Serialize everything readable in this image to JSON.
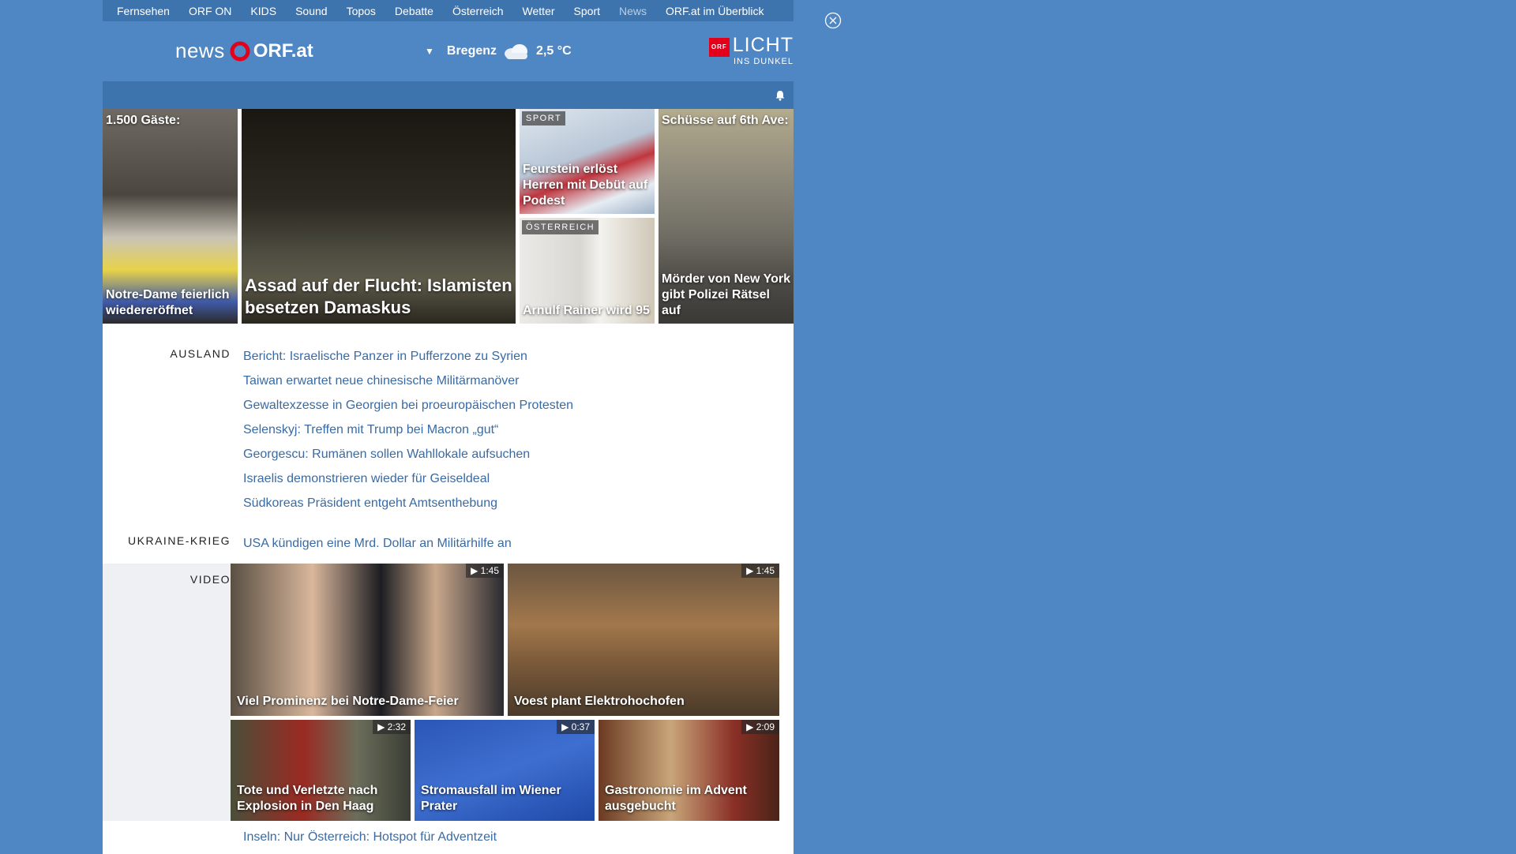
{
  "nav": {
    "items": [
      "Fernsehen",
      "ORF ON",
      "KIDS",
      "Sound",
      "Topos",
      "Debatte",
      "Österreich",
      "Wetter",
      "Sport",
      "News",
      "ORF.at im Überblick"
    ],
    "active": "News"
  },
  "header": {
    "logo_news": "news",
    "logo_orf": "ORF.at",
    "weather_city": "Bregenz",
    "weather_temp": "2,5 °C",
    "licht_badge": "ORF",
    "licht_line1": "LICHT",
    "licht_line2": "INS DUNKEL"
  },
  "hero": {
    "t1_top": "1.500 Gäste:",
    "t1_cap": "Notre-Dame feierlich wiedereröffnet",
    "t2_cap": "Assad auf der Flucht: Islamisten besetzen Damaskus",
    "t3_tag": "SPORT",
    "t3_cap": "Feurstein erlöst Herren mit Debüt auf Podest",
    "t4_tag": "ÖSTERREICH",
    "t4_cap": "Arnulf Rainer wird 95",
    "t5_top": "Schüsse auf 6th Ave:",
    "t5_cap": "Mörder von New York gibt Polizei Rätsel auf"
  },
  "sections": [
    {
      "label": "AUSLAND",
      "items": [
        "Bericht: Israelische Panzer in Pufferzone zu Syrien",
        "Taiwan erwartet neue chinesische Militärmanöver",
        "Gewaltexzesse in Georgien bei proeuropäischen Protesten",
        "Selenskyj: Treffen mit Trump bei Macron „gut“",
        "Georgescu: Rumänen sollen Wahllokale aufsuchen",
        "Israelis demonstrieren wieder für Geiseldeal",
        "Südkoreas Präsident entgeht Amtsenthebung"
      ]
    },
    {
      "label": "UKRAINE-KRIEG",
      "items": [
        "USA kündigen eine Mrd. Dollar an Militärhilfe an"
      ]
    }
  ],
  "video": {
    "label": "VIDEO",
    "tiles": [
      {
        "caption": "Viel Prominenz bei Notre-Dame-Feier",
        "duration": "1:45"
      },
      {
        "caption": "Voest plant Elektrohochofen",
        "duration": "1:45"
      },
      {
        "caption": "Tote und Verletzte nach Explosion in Den Haag",
        "duration": "2:32"
      },
      {
        "caption": "Stromausfall im Wiener Prater",
        "duration": "0:37"
      },
      {
        "caption": "Gastronomie im Advent ausgebucht",
        "duration": "2:09"
      }
    ]
  },
  "bottom_line": "Inseln: Nur Österreich: Hotspot für Adventzeit"
}
